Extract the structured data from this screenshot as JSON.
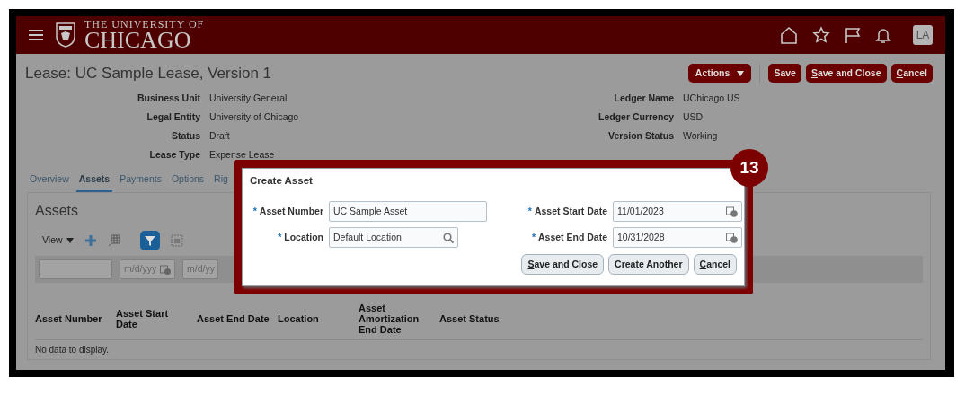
{
  "header": {
    "logo_top": "THE UNIVERSITY OF",
    "logo_main": "CHICAGO",
    "avatar": "LA"
  },
  "page": {
    "title": "Lease: UC Sample Lease, Version 1",
    "actions_menu": "Actions",
    "buttons": [
      {
        "label": "Save",
        "mnemonic": false
      },
      {
        "label": "Save and Close",
        "mnemonic": true
      },
      {
        "label": "Cancel",
        "mnemonic": true
      }
    ]
  },
  "details_left": [
    {
      "label": "Business Unit",
      "value": "University General"
    },
    {
      "label": "Legal Entity",
      "value": "University of Chicago"
    },
    {
      "label": "Status",
      "value": "Draft"
    },
    {
      "label": "Lease Type",
      "value": "Expense Lease"
    }
  ],
  "details_right": [
    {
      "label": "Ledger Name",
      "value": "UChicago US"
    },
    {
      "label": "Ledger Currency",
      "value": "USD"
    },
    {
      "label": "Version Status",
      "value": "Working"
    }
  ],
  "tabs": [
    {
      "label": "Overview",
      "selected": false
    },
    {
      "label": "Assets",
      "selected": true
    },
    {
      "label": "Payments",
      "selected": false
    },
    {
      "label": "Options",
      "selected": false
    },
    {
      "label": "Rig",
      "selected": false
    }
  ],
  "assets": {
    "heading": "Assets",
    "view_menu": "View",
    "filter_fields": [
      {
        "kind": "text"
      },
      {
        "kind": "date",
        "placeholder": "m/d/yyy"
      },
      {
        "kind": "partial",
        "placeholder": "m/d/yy"
      }
    ],
    "columns": [
      "Asset Number",
      "Asset Start Date",
      "Asset End Date",
      "Location",
      "Asset Amortization End Date",
      "Asset Status"
    ],
    "empty_message": "No data to display."
  },
  "dialog": {
    "title": "Create Asset",
    "fields": [
      {
        "label": "Asset Number",
        "value": "UC Sample Asset",
        "required_mark": "*",
        "kind": "text"
      },
      {
        "label": "Asset Start Date",
        "value": "11/01/2023",
        "required_mark": "*",
        "kind": "date"
      },
      {
        "label": "Location",
        "value": "Default Location",
        "required_mark": "*",
        "kind": "search"
      },
      {
        "label": "Asset End Date",
        "value": "10/31/2028",
        "required_mark": "*",
        "kind": "date"
      }
    ],
    "buttons": [
      {
        "label": "Save and Close",
        "mnemonic": true
      },
      {
        "label": "Create Another",
        "mnemonic": false
      },
      {
        "label": "Cancel",
        "mnemonic": true
      }
    ]
  },
  "callout": "13"
}
